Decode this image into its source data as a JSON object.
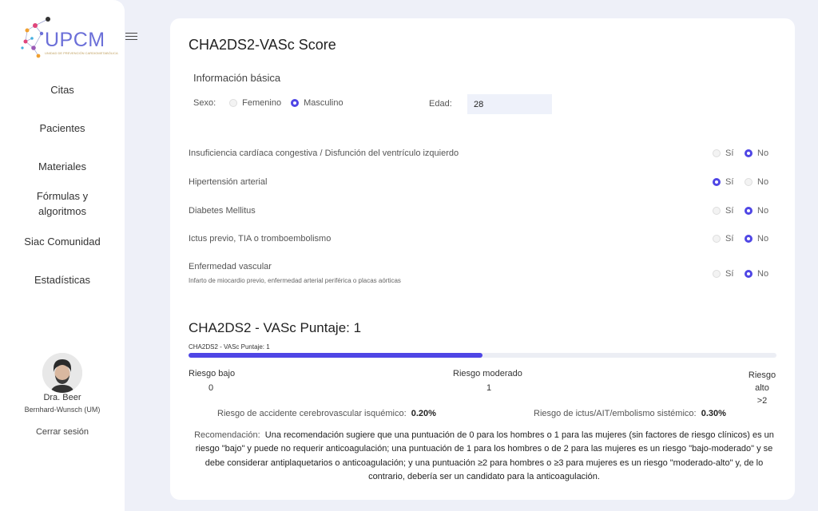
{
  "app": {
    "logo_text": "UPCM",
    "logo_sub": "UNIDAD DE PREVENCIÓN CARDIOMETABÓLICA"
  },
  "sidebar": {
    "items": [
      {
        "label": "Citas"
      },
      {
        "label": "Pacientes"
      },
      {
        "label": "Materiales"
      },
      {
        "label": "Fórmulas y algoritmos"
      },
      {
        "label": "Siac Comunidad"
      },
      {
        "label": "Estadísticas"
      }
    ],
    "user_name": "Dra. Beer",
    "user_org": "Bernhard-Wunsch (UM)",
    "logout": "Cerrar sesión"
  },
  "form": {
    "title": "CHA2DS2-VASc Score",
    "section": "Información básica",
    "sex_label": "Sexo:",
    "sex_options": [
      "Femenino",
      "Masculino"
    ],
    "sex_selected": "Masculino",
    "age_label": "Edad:",
    "age_value": "28",
    "yes_label": "Sí",
    "no_label": "No",
    "questions": [
      {
        "label": "Insuficiencia cardíaca congestiva / Disfunción del ventrículo izquierdo",
        "hint": "",
        "answer": "No"
      },
      {
        "label": "Hipertensión arterial",
        "hint": "",
        "answer": "Sí"
      },
      {
        "label": "Diabetes Mellitus",
        "hint": "",
        "answer": "No"
      },
      {
        "label": "Ictus previo, TIA o tromboembolismo",
        "hint": "",
        "answer": "No"
      },
      {
        "label": "Enfermedad vascular",
        "hint": "Infarto de miocardio previo, enfermedad arterial periférica o placas aórticas",
        "answer": "No"
      }
    ]
  },
  "result": {
    "title": "CHA2DS2 - VASc Puntaje: 1",
    "bar_caption": "CHA2DS2 - VASc Puntaje: 1",
    "progress_fraction": 0.5,
    "risk_low": "Riesgo bajo",
    "risk_low_value": "0",
    "risk_mid": "Riesgo moderado",
    "risk_mid_value": "1",
    "risk_high": "Riesgo alto",
    "risk_high_value": ">2",
    "stroke_label": "Riesgo de accidente cerebrovascular isquémico:",
    "stroke_value": "0.20%",
    "embolism_label": "Riesgo de ictus/AIT/embolismo sistémico:",
    "embolism_value": "0.30%",
    "recommendation_label": "Recomendación:",
    "recommendation_text": "Una recomendación sugiere que una puntuación de 0 para los hombres o 1 para las mujeres (sin factores de riesgo clínicos) es un riesgo \"bajo\" y puede no requerir anticoagulación; una puntuación de 1 para los hombres o de 2 para las mujeres es un riesgo \"bajo-moderado\" y se debe considerar antiplaquetarios o anticoagulación; y una puntuación ≥2 para hombres o ≥3 para mujeres es un riesgo \"moderado-alto\" y, de lo contrario, debería ser un candidato para la anticoagulación."
  },
  "colors": {
    "accent": "#4f46e5",
    "background": "#eef0f8"
  }
}
